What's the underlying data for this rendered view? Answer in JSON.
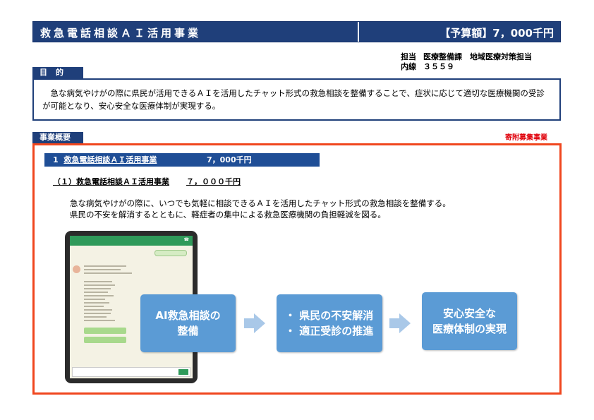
{
  "header": {
    "title": "救急電話相談ＡＩ活用事業",
    "budget": "【予算額】7，000千円"
  },
  "contact": {
    "line1_label": "担当",
    "line1_value": "医療整備課　地域医療対策担当",
    "line2_label": "内線",
    "line2_value": "３５５９"
  },
  "purpose": {
    "tag": "目的",
    "text": "急な病気やけがの際に県民が活用できるＡＩを活用したチャット形式の救急相談を整備することで、症状に応じて適切な医療機関の受診が可能となり、安心安全な医療体制が実現する。"
  },
  "overview": {
    "tag": "事業概要",
    "donation_label": "寄附募集事業",
    "section": {
      "number": "1",
      "title": "救急電話相談ＡＩ活用事業",
      "amount": "7，000千円"
    },
    "subsection": {
      "title": "（１）救急電話相談ＡＩ活用事業",
      "amount": "７，０００千円"
    },
    "description": [
      "急な病気やけがの際に、いつでも気軽に相談できるＡＩを活用したチャット形式の救急相談を整備する。",
      "県民の不安を解消するとともに、軽症者の集中による救急医療機関の負担軽減を図る。"
    ],
    "flow": [
      {
        "lines": [
          "AI救急相談の",
          "整備"
        ]
      },
      {
        "lines": [
          "・ 県民の不安解消",
          "・ 適正受診の推進"
        ]
      },
      {
        "lines": [
          "安心安全な",
          "医療体制の実現"
        ]
      }
    ]
  },
  "colors": {
    "navy": "#1f3f7a",
    "section_blue": "#1f4e96",
    "flow_blue": "#5b9bd5",
    "arrow_blue": "#a9c8e8",
    "border_red": "#f0461e",
    "donation_red": "#e0000a",
    "chat_green": "#2f9a5a"
  }
}
